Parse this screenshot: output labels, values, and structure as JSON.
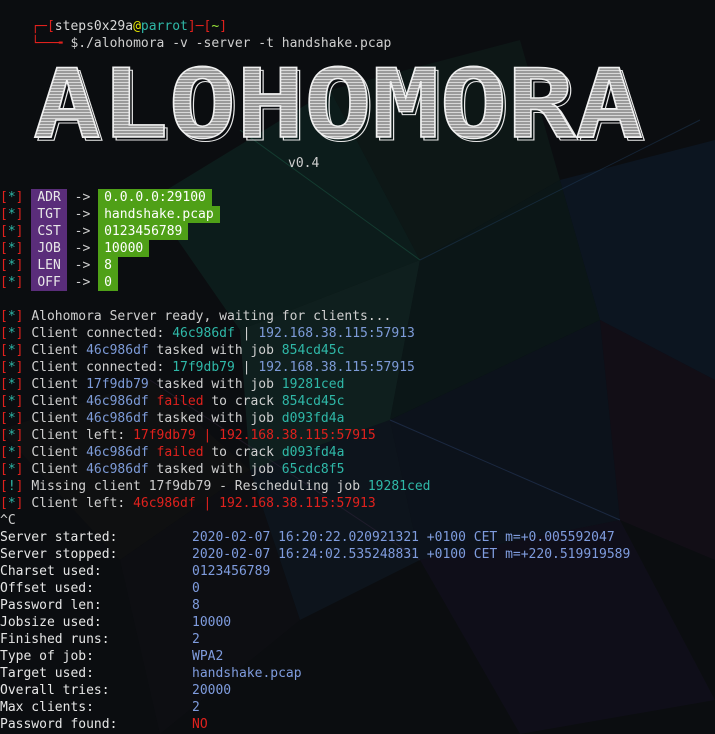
{
  "prompt": {
    "user": "steps0x29a",
    "at": "@",
    "host": "parrot",
    "dir": "~",
    "command": "$./alohomora -v -server -t handshake.pcap"
  },
  "banner": {
    "title": "ALOHOMORA",
    "version": "v0.4"
  },
  "config": [
    {
      "prefix": "[*]",
      "key": "ADR",
      "arrow": "->",
      "value": "0.0.0.0:29100"
    },
    {
      "prefix": "[*]",
      "key": "TGT",
      "arrow": "->",
      "value": "handshake.pcap"
    },
    {
      "prefix": "[*]",
      "key": "CST",
      "arrow": "->",
      "value": "0123456789"
    },
    {
      "prefix": "[*]",
      "key": "JOB",
      "arrow": "->",
      "value": "10000"
    },
    {
      "prefix": "[*]",
      "key": "LEN",
      "arrow": "->",
      "value": "8"
    },
    {
      "prefix": "[*]",
      "key": "OFF",
      "arrow": "->",
      "value": "0"
    }
  ],
  "log": [
    {
      "prefix": "[*]",
      "parts": [
        {
          "t": "Alohomora Server ready, waiting for clients...",
          "c": "gray"
        }
      ]
    },
    {
      "prefix": "[*]",
      "parts": [
        {
          "t": "Client connected: ",
          "c": "gray"
        },
        {
          "t": "46c986df",
          "c": "teal"
        },
        {
          "t": " | ",
          "c": "gray"
        },
        {
          "t": "192.168.38.115:57913",
          "c": "blue"
        }
      ]
    },
    {
      "prefix": "[*]",
      "parts": [
        {
          "t": "Client ",
          "c": "gray"
        },
        {
          "t": "46c986df",
          "c": "blue"
        },
        {
          "t": " tasked with job ",
          "c": "gray"
        },
        {
          "t": "854cd45c",
          "c": "teal"
        }
      ]
    },
    {
      "prefix": "[*]",
      "parts": [
        {
          "t": "Client connected: ",
          "c": "gray"
        },
        {
          "t": "17f9db79",
          "c": "teal"
        },
        {
          "t": " | ",
          "c": "gray"
        },
        {
          "t": "192.168.38.115:57915",
          "c": "blue"
        }
      ]
    },
    {
      "prefix": "[*]",
      "parts": [
        {
          "t": "Client ",
          "c": "gray"
        },
        {
          "t": "17f9db79",
          "c": "blue"
        },
        {
          "t": " tasked with job ",
          "c": "gray"
        },
        {
          "t": "19281ced",
          "c": "teal"
        }
      ]
    },
    {
      "prefix": "[*]",
      "parts": [
        {
          "t": "Client ",
          "c": "gray"
        },
        {
          "t": "46c986df",
          "c": "blue"
        },
        {
          "t": " failed",
          "c": "red"
        },
        {
          "t": " to crack ",
          "c": "gray"
        },
        {
          "t": "854cd45c",
          "c": "teal"
        }
      ]
    },
    {
      "prefix": "[*]",
      "parts": [
        {
          "t": "Client ",
          "c": "gray"
        },
        {
          "t": "46c986df",
          "c": "blue"
        },
        {
          "t": " tasked with job ",
          "c": "gray"
        },
        {
          "t": "d093fd4a",
          "c": "teal"
        }
      ]
    },
    {
      "prefix": "[*]",
      "parts": [
        {
          "t": "Client left: ",
          "c": "gray"
        },
        {
          "t": "17f9db79 | 192.168.38.115:57915",
          "c": "red"
        }
      ]
    },
    {
      "prefix": "[*]",
      "parts": [
        {
          "t": "Client ",
          "c": "gray"
        },
        {
          "t": "46c986df",
          "c": "blue"
        },
        {
          "t": " failed",
          "c": "red"
        },
        {
          "t": " to crack ",
          "c": "gray"
        },
        {
          "t": "d093fd4a",
          "c": "teal"
        }
      ]
    },
    {
      "prefix": "[*]",
      "parts": [
        {
          "t": "Client ",
          "c": "gray"
        },
        {
          "t": "46c986df",
          "c": "blue"
        },
        {
          "t": " tasked with job ",
          "c": "gray"
        },
        {
          "t": "65cdc8f5",
          "c": "teal"
        }
      ]
    },
    {
      "prefix": "[!]",
      "parts": [
        {
          "t": "Missing client 17f9db79 - Rescheduling job ",
          "c": "gray"
        },
        {
          "t": "19281ced",
          "c": "teal"
        }
      ]
    },
    {
      "prefix": "[*]",
      "parts": [
        {
          "t": "Client left: ",
          "c": "gray"
        },
        {
          "t": "46c986df | 192.168.38.115:57913",
          "c": "red"
        }
      ]
    }
  ],
  "interrupt": "^C",
  "summary": [
    {
      "key": "Server started:",
      "value": "2020-02-07 16:20:22.020921321 +0100 CET m=+0.005592047"
    },
    {
      "key": "Server stopped:",
      "value": "2020-02-07 16:24:02.535248831 +0100 CET m=+220.519919589"
    },
    {
      "key": "Charset used:",
      "value": "0123456789"
    },
    {
      "key": "Offset used:",
      "value": "0"
    },
    {
      "key": "Password len:",
      "value": "8"
    },
    {
      "key": "Jobsize used:",
      "value": "10000"
    },
    {
      "key": "Finished runs:",
      "value": "2"
    },
    {
      "key": "Type of job:",
      "value": "WPA2"
    },
    {
      "key": "Target used:",
      "value": "handshake.pcap"
    },
    {
      "key": "Overall tries:",
      "value": "20000"
    },
    {
      "key": "Max clients:",
      "value": "2"
    },
    {
      "key": "Password found:",
      "value": "NO",
      "color": "red"
    }
  ],
  "colors": {
    "background": "#0b0d10",
    "red": "#e0211d",
    "teal": "#2fb8a8",
    "blue": "#7d9bd8",
    "purple_key_bg": "#5a2d7a",
    "green_val_bg": "#4fa017"
  }
}
